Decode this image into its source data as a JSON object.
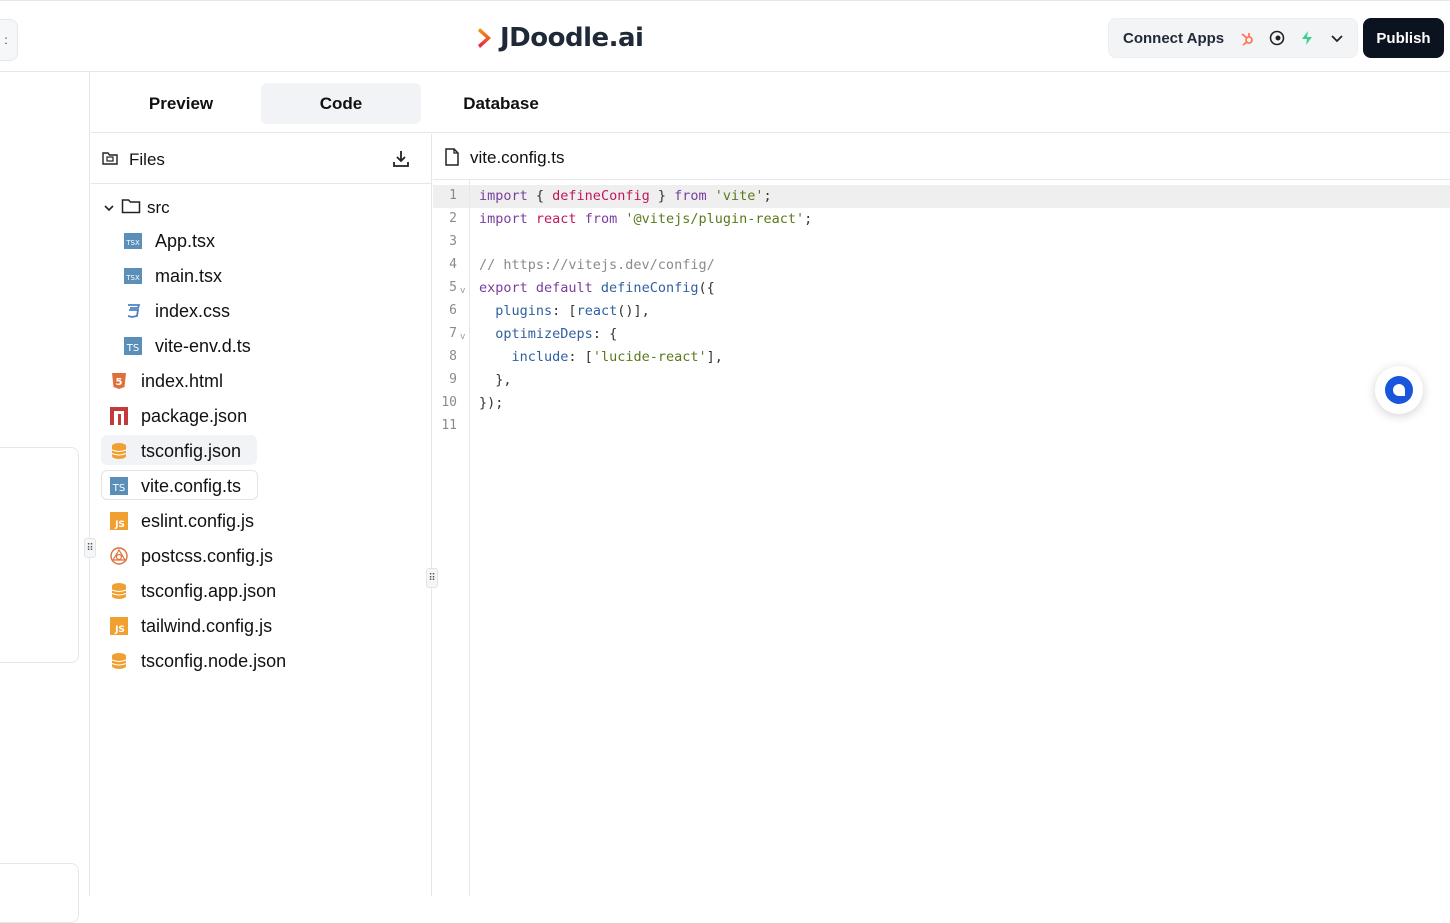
{
  "header": {
    "collapse_glyph": ":",
    "brand": "JDoodle.ai",
    "connect_label": "Connect Apps",
    "connect_icons": [
      "hubspot-icon",
      "mailchimp-icon",
      "supabase-icon"
    ],
    "publish_label": "Publish"
  },
  "tabs": [
    {
      "label": "Preview",
      "active": false
    },
    {
      "label": "Code",
      "active": true
    },
    {
      "label": "Database",
      "active": false
    }
  ],
  "files": {
    "title": "Files",
    "folder": "src",
    "src_items": [
      "App.tsx",
      "main.tsx",
      "index.css",
      "vite-env.d.ts"
    ],
    "root_items": [
      "index.html",
      "package.json",
      "tsconfig.json",
      "vite.config.ts",
      "eslint.config.js",
      "postcss.config.js",
      "tsconfig.app.json",
      "tailwind.config.js",
      "tsconfig.node.json"
    ],
    "selected": "vite.config.ts",
    "hovered": "tsconfig.json"
  },
  "editor": {
    "filename": "vite.config.ts",
    "line_numbers": [
      "1",
      "2",
      "3",
      "4",
      "5",
      "6",
      "7",
      "8",
      "9",
      "10",
      "11"
    ],
    "fold_marker": "v",
    "lines": {
      "l1_import": "import",
      "l1_brace_open": " { ",
      "l1_define": "defineConfig",
      "l1_brace_close": " } ",
      "l1_from": "from",
      "l1_str": " 'vite'",
      "l1_semi": ";",
      "l2_import": "import",
      "l2_react": " react ",
      "l2_from": "from",
      "l2_str": " '@vitejs/plugin-react'",
      "l2_semi": ";",
      "l4_comment": "// https://vitejs.dev/config/",
      "l5_export": "export default",
      "l5_fn": " defineConfig",
      "l5_rest": "({",
      "l6_indent": "  ",
      "l6_prop": "plugins",
      "l6_a": ": [",
      "l6_fn": "react",
      "l6_b": "()],",
      "l7_indent": "  ",
      "l7_prop": "optimizeDeps",
      "l7_a": ": {",
      "l8_indent": "    ",
      "l8_prop": "include",
      "l8_a": ": [",
      "l8_str": "'lucide-react'",
      "l8_b": "],",
      "l9": "  },",
      "l10": "});"
    }
  },
  "colors": {
    "accent": "#1a56db",
    "publish_bg": "#0b1220",
    "keyword": "#7a3e9d",
    "string": "#5a7a1a"
  }
}
